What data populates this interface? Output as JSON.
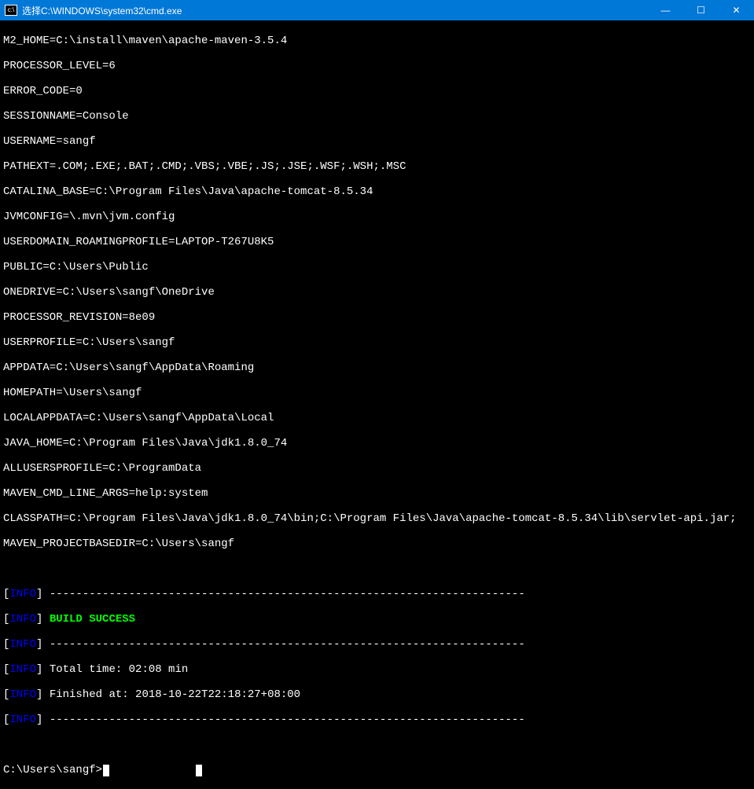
{
  "titlebar": {
    "icon_label": "cmd",
    "title": "选择C:\\WINDOWS\\system32\\cmd.exe",
    "minimize": "—",
    "maximize": "☐",
    "close": "✕"
  },
  "env_lines": [
    "M2_HOME=C:\\install\\maven\\apache-maven-3.5.4",
    "PROCESSOR_LEVEL=6",
    "ERROR_CODE=0",
    "SESSIONNAME=Console",
    "USERNAME=sangf",
    "PATHEXT=.COM;.EXE;.BAT;.CMD;.VBS;.VBE;.JS;.JSE;.WSF;.WSH;.MSC",
    "CATALINA_BASE=C:\\Program Files\\Java\\apache-tomcat-8.5.34",
    "JVMCONFIG=\\.mvn\\jvm.config",
    "USERDOMAIN_ROAMINGPROFILE=LAPTOP-T267U8K5",
    "PUBLIC=C:\\Users\\Public",
    "ONEDRIVE=C:\\Users\\sangf\\OneDrive",
    "PROCESSOR_REVISION=8e09",
    "USERPROFILE=C:\\Users\\sangf",
    "APPDATA=C:\\Users\\sangf\\AppData\\Roaming",
    "HOMEPATH=\\Users\\sangf",
    "LOCALAPPDATA=C:\\Users\\sangf\\AppData\\Local",
    "JAVA_HOME=C:\\Program Files\\Java\\jdk1.8.0_74",
    "ALLUSERSPROFILE=C:\\ProgramData",
    "MAVEN_CMD_LINE_ARGS=help:system",
    "CLASSPATH=C:\\Program Files\\Java\\jdk1.8.0_74\\bin;C:\\Program Files\\Java\\apache-tomcat-8.5.34\\lib\\servlet-api.jar;",
    "MAVEN_PROJECTBASEDIR=C:\\Users\\sangf"
  ],
  "info": {
    "tag": "INFO",
    "dashes": "------------------------------------------------------------------------",
    "build_success": "BUILD SUCCESS",
    "total_time": "Total time: 02:08 min",
    "finished_at": "Finished at: 2018-10-22T22:18:27+08:00"
  },
  "prompt": "C:\\Users\\sangf>"
}
